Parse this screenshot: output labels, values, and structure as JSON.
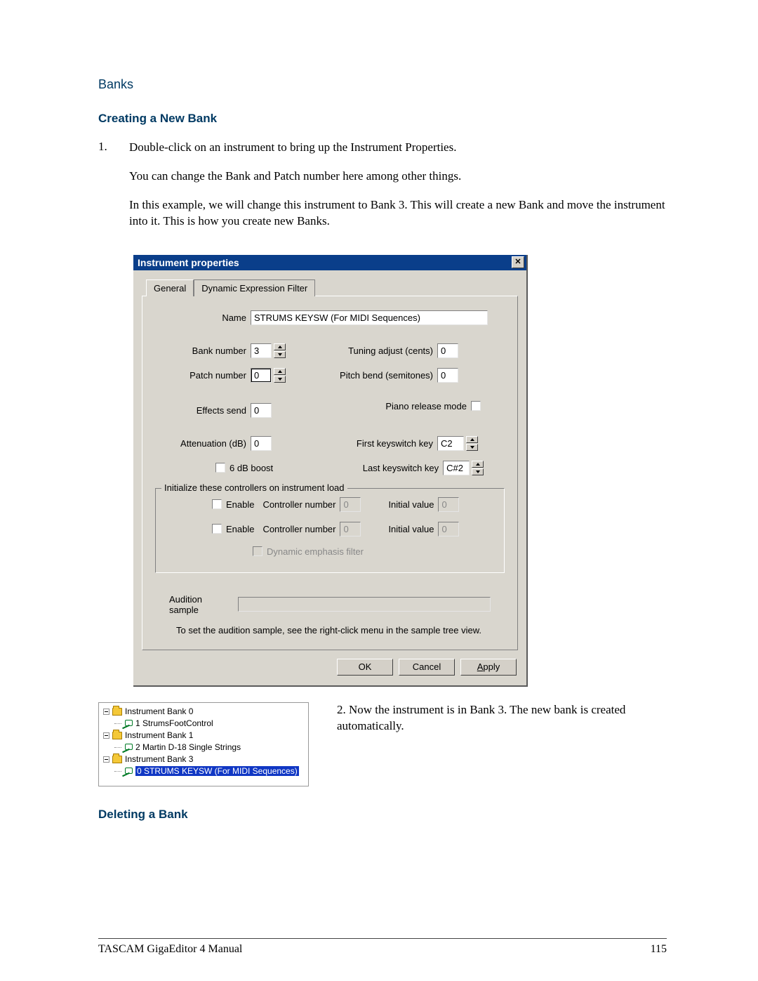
{
  "page": {
    "section_title": "Banks",
    "subheading_create": "Creating a New Bank",
    "subheading_delete": "Deleting a Bank",
    "step1_num": "1.",
    "step1_line1": "Double-click on an instrument to bring up the Instrument Properties.",
    "step1_line2": "You can change the Bank and Patch number here among other things.",
    "step1_line3": "In this example, we will change this instrument to Bank 3. This will create a new Bank and move the instrument into it.  This is how you create new Banks.",
    "step2_num": "2.",
    "step2_text": " Now the instrument is in Bank 3.  The new bank is created automatically."
  },
  "dialog": {
    "title": "Instrument properties",
    "tab_general": "General",
    "tab_dynfilter": "Dynamic Expression Filter",
    "name_label": "Name",
    "name_value": "STRUMS KEYSW (For MIDI Sequences)",
    "bank_label": "Bank number",
    "bank_value": "3",
    "patch_label": "Patch number",
    "patch_value": "0",
    "tuning_label": "Tuning adjust (cents)",
    "tuning_value": "0",
    "pitchbend_label": "Pitch bend (semitones)",
    "pitchbend_value": "0",
    "piano_label": "Piano release mode",
    "fx_label": "Effects send",
    "fx_value": "0",
    "att_label": "Attenuation (dB)",
    "att_value": "0",
    "boost_label": "6 dB boost",
    "first_ks_label": "First keyswitch key",
    "first_ks_value": "C2",
    "last_ks_label": "Last keyswitch key",
    "last_ks_value": "C#2",
    "group_title": "Initialize these controllers on instrument load",
    "enable_label": "Enable",
    "ctrl_num_label": "Controller number",
    "ctrl_num_value": "0",
    "init_val_label": "Initial value",
    "init_val_value": "0",
    "dyn_emph_label": "Dynamic emphasis filter",
    "audition_label": "Audition sample",
    "audition_hint": "To set the audition sample, see the right-click menu in the sample tree view.",
    "btn_ok": "OK",
    "btn_cancel": "Cancel",
    "btn_apply_u": "A",
    "btn_apply_rest": "pply"
  },
  "tree": {
    "bank0": "Instrument Bank 0",
    "bank0_item": "1 StrumsFootControl",
    "bank1": "Instrument Bank 1",
    "bank1_item": "2 Martin D-18 Single Strings",
    "bank3": "Instrument Bank 3",
    "bank3_item": "0 STRUMS KEYSW (For MIDI Sequences)"
  },
  "footer": {
    "left": "TASCAM GigaEditor 4 Manual",
    "right": "115"
  }
}
